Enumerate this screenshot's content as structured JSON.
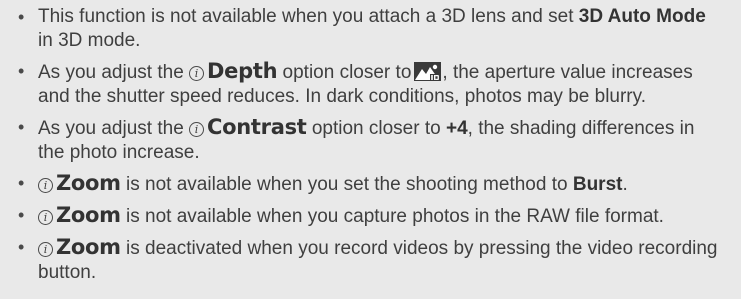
{
  "notes": [
    {
      "part1": "This function is not available when you attach a 3D lens and set",
      "bold1": "3D Auto Mode",
      "part2": "in 3D mode."
    },
    {
      "part1": "As you adjust the",
      "key": "Depth",
      "part2": "option closer to",
      "icon": "mountain-depth-icon",
      "part3": ", the aperture value increases and the shutter speed reduces. In dark conditions, photos may be blurry."
    },
    {
      "part1": "As you adjust the",
      "key": "Contrast",
      "part2": "option closer to",
      "bold1": "+4",
      "part3": ", the shading differences in the photo increase."
    },
    {
      "key": "Zoom",
      "part1": "is not available when you set the shooting method to",
      "bold1": "Burst",
      "part2": "."
    },
    {
      "key": "Zoom",
      "part1": "is not available when you capture photos in the RAW file format."
    },
    {
      "key": "Zoom",
      "part1": "is deactivated when you record videos by pressing the video recording button."
    }
  ],
  "icons": {
    "bullet": "•",
    "i_function": "i",
    "depth_icon_name": "mountain-depth-icon"
  }
}
